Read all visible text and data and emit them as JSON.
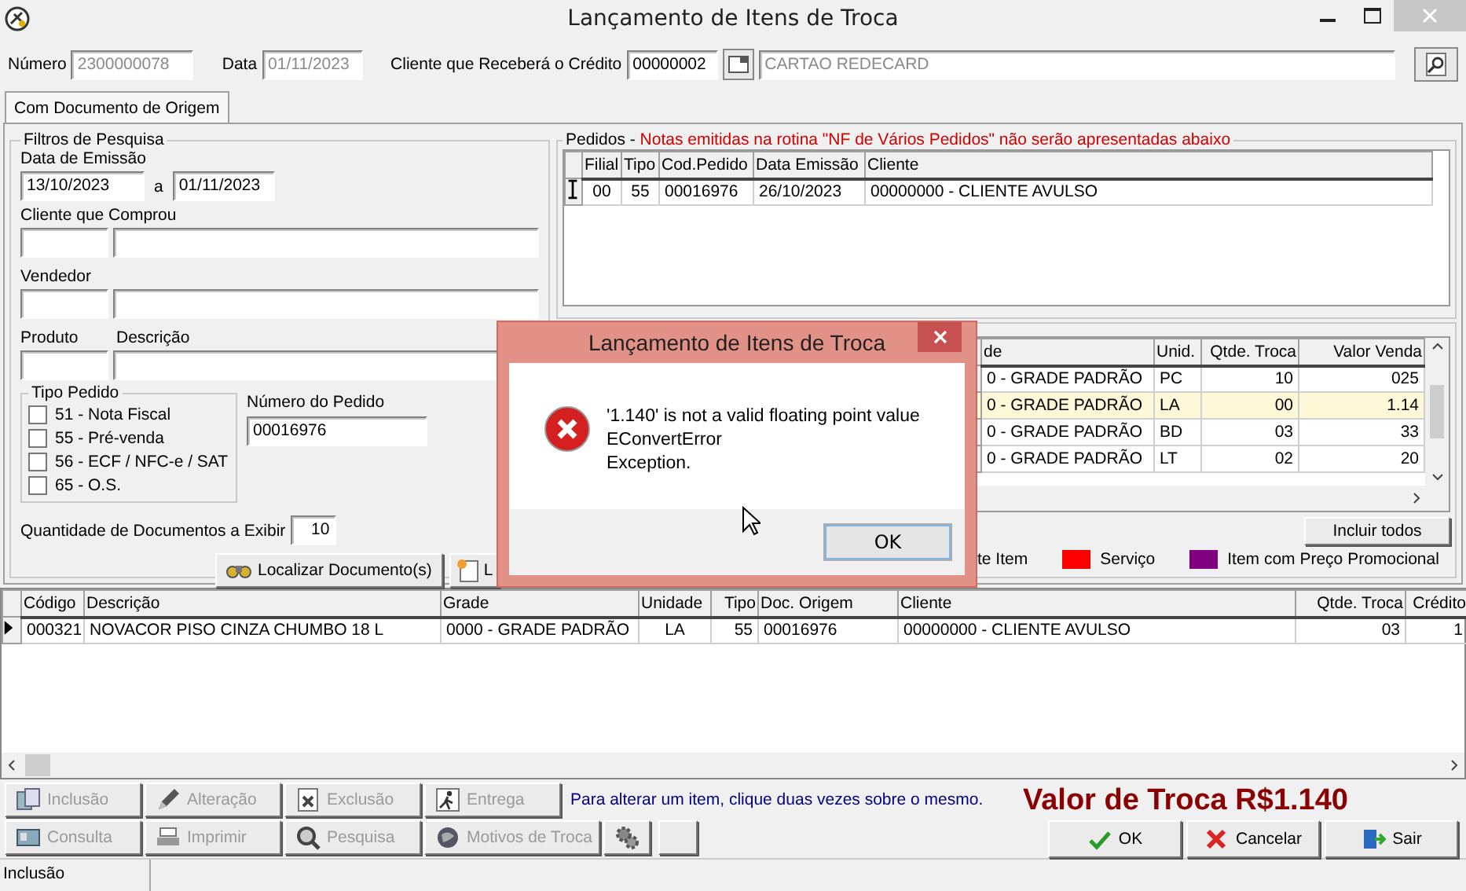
{
  "window": {
    "title": "Lançamento de Itens de Troca"
  },
  "header": {
    "number": {
      "label": "Número",
      "value": "2300000078",
      "disabled": true
    },
    "date": {
      "label": "Data",
      "value": "01/11/2023",
      "disabled": true
    },
    "client": {
      "label": "Cliente que Receberá o Crédito",
      "code": "00000002",
      "name": "CARTAO REDECARD",
      "name_disabled": true
    }
  },
  "tabs": [
    {
      "label": "Com Documento de Origem",
      "selected": true
    }
  ],
  "filters": {
    "title": "Filtros de Pesquisa",
    "emission": {
      "label": "Data de Emissão",
      "from": "13/10/2023",
      "separator": "a",
      "to": "01/11/2023"
    },
    "client_label": "Cliente que Comprou",
    "seller_label": "Vendedor",
    "product_label": "Produto",
    "description_label": "Descrição",
    "order_types": {
      "title": "Tipo Pedido",
      "items": [
        {
          "label": "51 - Nota Fiscal",
          "checked": false
        },
        {
          "label": "55 - Pré-venda",
          "checked": false
        },
        {
          "label": "56 - ECF / NFC-e / SAT",
          "checked": false
        },
        {
          "label": "65 - O.S.",
          "checked": false
        }
      ]
    },
    "order_number": {
      "label": "Número do Pedido",
      "value": "00016976"
    },
    "quantity": {
      "label": "Quantidade de Documentos a Exibir",
      "value": "10"
    },
    "buttons": [
      {
        "label": "Localizar Documento(s)"
      },
      {
        "label": "L"
      }
    ]
  },
  "orders": {
    "title": "Pedidos -",
    "note": "Notas emitidas na rotina \"NF de Vários Pedidos\" não serão apresentadas abaixo",
    "columns": [
      "Filial",
      "Tipo",
      "Cod.Pedido",
      "Data Emissão",
      "Cliente"
    ],
    "rows": [
      {
        "current": true,
        "cells": [
          "00",
          "55",
          "00016976",
          "26/10/2023",
          "00000000 - CLIENTE AVULSO"
        ]
      }
    ]
  },
  "items": {
    "columns": [
      "de",
      "Unid.",
      "Qtde. Troca",
      "Valor Venda"
    ],
    "rows": [
      {
        "selected": false,
        "cells": [
          "0 - GRADE PADRÃO",
          "PC",
          "10",
          "025"
        ]
      },
      {
        "selected": true,
        "cells": [
          "0 - GRADE PADRÃO",
          "LA",
          "00",
          "1.14"
        ]
      },
      {
        "selected": false,
        "cells": [
          "0 - GRADE PADRÃO",
          "BD",
          "03",
          "33"
        ]
      },
      {
        "selected": false,
        "cells": [
          "0 - GRADE PADRÃO",
          "LT",
          "02",
          "20"
        ]
      }
    ],
    "include_all": "Incluir todos",
    "legend": [
      {
        "label": "te Item"
      },
      {
        "label": "Serviço",
        "color": "#ff0000"
      },
      {
        "label": "Item com Preço Promocional",
        "color": "#800080"
      }
    ]
  },
  "exchange_grid": {
    "columns": [
      "Código",
      "Descrição",
      "Grade",
      "Unidade",
      "Tipo",
      "Doc. Origem",
      "Cliente",
      "Qtde. Troca",
      "Crédito"
    ],
    "rows": [
      {
        "current": true,
        "cells": [
          "000321",
          "NOVACOR PISO CINZA CHUMBO 18 L",
          "0000 - GRADE PADRÃO",
          "LA",
          "55",
          "00016976",
          "00000000 - CLIENTE AVULSO",
          "03",
          "1"
        ]
      }
    ]
  },
  "toolbar": {
    "row_1": [
      {
        "label": "Inclusão",
        "disabled": true
      },
      {
        "label": "Alteração",
        "disabled": true
      },
      {
        "label": "Exclusão",
        "disabled": true
      },
      {
        "label": "Entrega",
        "disabled": true
      }
    ],
    "row_2": [
      {
        "label": "Consulta",
        "disabled": true
      },
      {
        "label": "Imprimir",
        "disabled": true
      },
      {
        "label": "Pesquisa",
        "disabled": true
      },
      {
        "label": "Motivos de Troca",
        "disabled": true
      }
    ],
    "hint": "Para alterar um item, clique duas vezes sobre o mesmo."
  },
  "total": "Valor de Troca R$1.140",
  "actions": [
    {
      "label": "OK"
    },
    {
      "label": "Cancelar"
    },
    {
      "label": "Sair"
    }
  ],
  "status_bar": {
    "text": "Inclusão"
  },
  "dialog": {
    "title": "Lançamento de Itens de Troca",
    "message_lines": [
      "'1.140' is not a valid floating point value",
      "EConvertError",
      "Exception."
    ],
    "button": "OK"
  }
}
